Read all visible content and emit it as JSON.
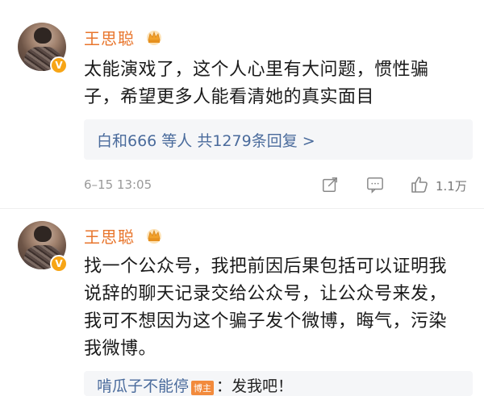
{
  "comments": [
    {
      "username": "王思聪",
      "avatar_badge": "V",
      "text": "太能演戏了，这个人心里有大问题，惯性骗子，希望更多人能看清她的真实面目",
      "reply_summary": "白和666 等人  共1279条回复 >",
      "time": "6–15 13:05",
      "likes": "1.1万",
      "icons": [
        "share-icon",
        "comment-icon",
        "like-icon"
      ]
    },
    {
      "username": "王思聪",
      "avatar_badge": "V",
      "text": "找一个公众号，我把前因后果包括可以证明我说辞的聊天记录交给公众号，让公众号来发，我可不想因为这个骗子发个微博，晦气，污染我微博。",
      "reply_preview_user": "啃瓜子不能停",
      "reply_preview_tag": "博主",
      "reply_preview_text": "：发我吧！"
    }
  ],
  "colors": {
    "username": "#e8752c",
    "link": "#4a6b9c",
    "badge": "#f7a516",
    "meta": "#9a9a9a"
  }
}
